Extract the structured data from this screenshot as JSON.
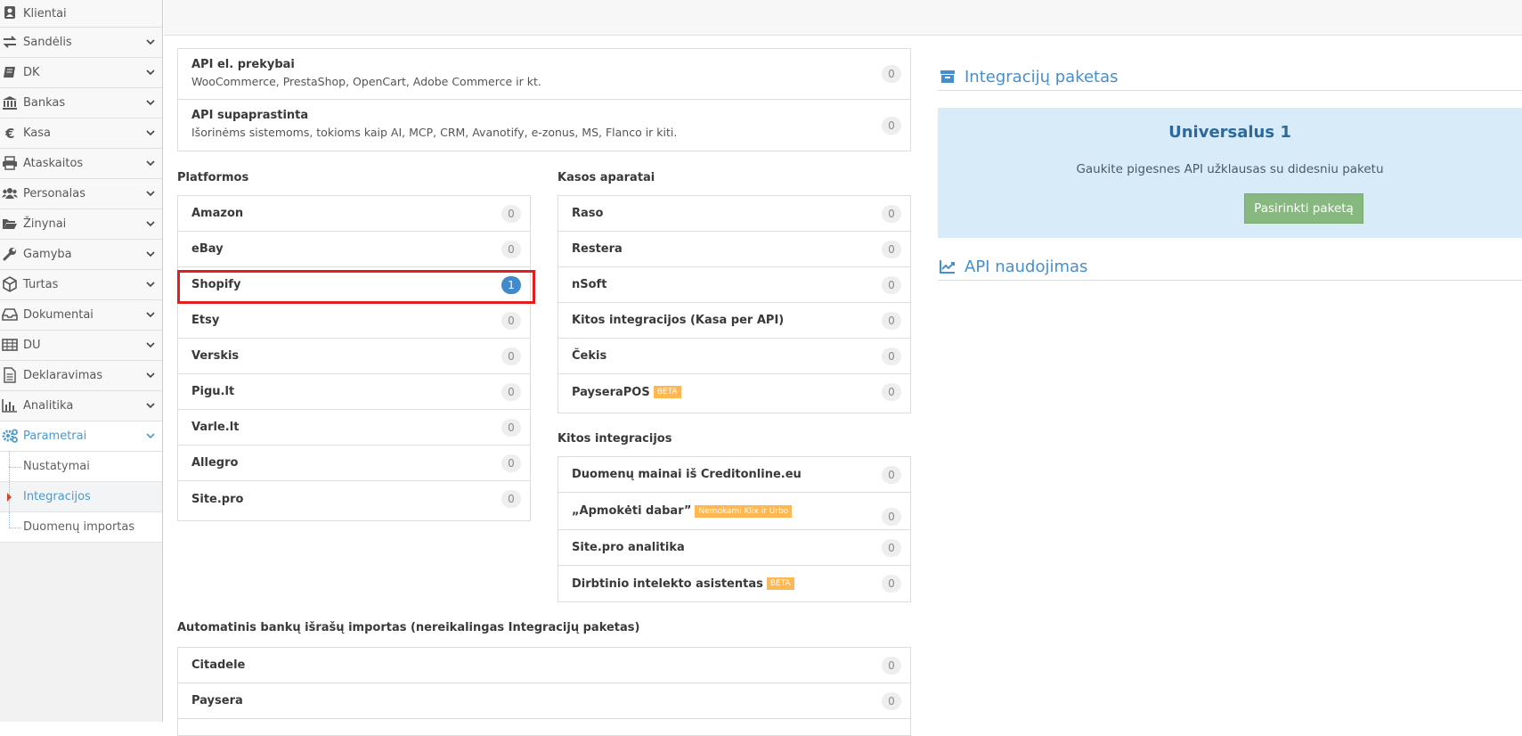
{
  "sidebar": {
    "items": [
      {
        "label": "Klientai",
        "icon": "user-icon",
        "chevron": false
      },
      {
        "label": "Sandėlis",
        "icon": "exchange-icon",
        "chevron": true
      },
      {
        "label": "DK",
        "icon": "book-icon",
        "chevron": true
      },
      {
        "label": "Bankas",
        "icon": "bank-icon",
        "chevron": true
      },
      {
        "label": "Kasa",
        "icon": "euro-icon",
        "chevron": true
      },
      {
        "label": "Ataskaitos",
        "icon": "print-icon",
        "chevron": true
      },
      {
        "label": "Personalas",
        "icon": "users-icon",
        "chevron": true
      },
      {
        "label": "Žinynai",
        "icon": "folder-icon",
        "chevron": true
      },
      {
        "label": "Gamyba",
        "icon": "wrench-icon",
        "chevron": true
      },
      {
        "label": "Turtas",
        "icon": "cube-icon",
        "chevron": true
      },
      {
        "label": "Dokumentai",
        "icon": "inbox-icon",
        "chevron": true
      },
      {
        "label": "DU",
        "icon": "table-icon",
        "chevron": true
      },
      {
        "label": "Deklaravimas",
        "icon": "file-icon",
        "chevron": true
      },
      {
        "label": "Analitika",
        "icon": "bar-chart-icon",
        "chevron": true
      },
      {
        "label": "Parametrai",
        "icon": "cogs-icon",
        "chevron": true,
        "active": true
      }
    ],
    "sub_items": [
      {
        "label": "Nustatymai"
      },
      {
        "label": "Integracijos",
        "current": true
      },
      {
        "label": "Duomenų importas"
      }
    ]
  },
  "api_panel": [
    {
      "title": "API el. prekybai",
      "subtitle": "WooCommerce, PrestaShop, OpenCart, Adobe Commerce ir kt.",
      "count": "0"
    },
    {
      "title": "API supaprastinta",
      "subtitle": "Išorinėms sistemoms, tokioms kaip AI, MCP, CRM, Avanotify, e-zonus, MS, Flanco ir kiti.",
      "count": "0"
    }
  ],
  "platforms": {
    "title": "Platformos",
    "items": [
      {
        "label": "Amazon",
        "count": "0"
      },
      {
        "label": "eBay",
        "count": "0"
      },
      {
        "label": "Shopify",
        "count": "1"
      },
      {
        "label": "Etsy",
        "count": "0"
      },
      {
        "label": "Verskis",
        "count": "0"
      },
      {
        "label": "Pigu.lt",
        "count": "0"
      },
      {
        "label": "Varle.lt",
        "count": "0"
      },
      {
        "label": "Allegro",
        "count": "0"
      },
      {
        "label": "Site.pro",
        "count": "0"
      }
    ]
  },
  "cash_registers": {
    "title": "Kasos aparatai",
    "items": [
      {
        "label": "Raso",
        "count": "0"
      },
      {
        "label": "Restera",
        "count": "0"
      },
      {
        "label": "nSoft",
        "count": "0"
      },
      {
        "label": "Kitos integracijos (Kasa per API)",
        "count": "0"
      },
      {
        "label": "Čekis",
        "count": "0"
      },
      {
        "label": "PayseraPOS",
        "tag": "BETA",
        "count": "0"
      }
    ]
  },
  "other": {
    "title": "Kitos integracijos",
    "items": [
      {
        "label": "Duomenų mainai iš Creditonline.eu",
        "count": "0"
      },
      {
        "label": "„Apmokėti dabar”",
        "tag": "Nemokami Klix ir Urbo",
        "count": "0"
      },
      {
        "label": "Site.pro analitika",
        "count": "0"
      },
      {
        "label": "Dirbtinio intelekto asistentas",
        "tag": "BETA",
        "count": "0"
      }
    ]
  },
  "bank_import": {
    "title": "Automatinis bankų išrašų importas (nereikalingas Integracijų paketas)",
    "items": [
      {
        "label": "Citadele",
        "count": "0"
      },
      {
        "label": "Paysera",
        "count": "0"
      }
    ]
  },
  "right": {
    "package_heading": "Integracijų paketas",
    "package_name": "Universalus 1",
    "package_desc": "Gaukite pigesnes API užklausas su didesniu paketu",
    "package_button": "Pasirinkti paketą",
    "usage_heading": "API naudojimas"
  },
  "colors": {
    "accent": "#478fca",
    "tag": "#ffb752",
    "button": "#87b87f",
    "badge_blue": "#428bca",
    "highlight": "#e02020"
  }
}
